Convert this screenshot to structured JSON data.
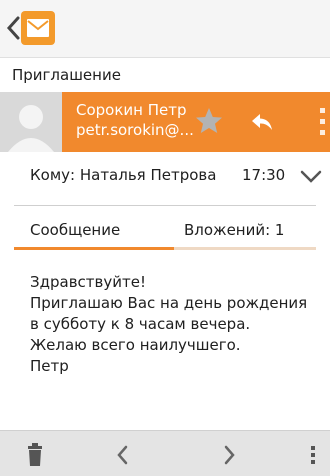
{
  "header": {
    "back_icon": "chevron-left-icon",
    "app_icon": "envelope-icon",
    "accent_color": "#f1892d"
  },
  "message": {
    "subject": "Приглашение",
    "sender_name": "Сорокин Петр",
    "sender_email": "petr.sorokin@...",
    "to_label": "Кому: Наталья Петрова",
    "time": "17:30",
    "tab_message": "Сообщение",
    "tab_attachments": "Вложений: 1",
    "body_lines": [
      "Здравствуйте!",
      "Приглашаю Вас на день рождения",
      "в субботу к 8 часам вечера.",
      "Желаю всего наилучшего.",
      "Петр"
    ]
  },
  "toolbar": {
    "icons": [
      "trash-icon",
      "chevron-left-icon",
      "chevron-right-icon",
      "more-vertical-icon"
    ]
  }
}
